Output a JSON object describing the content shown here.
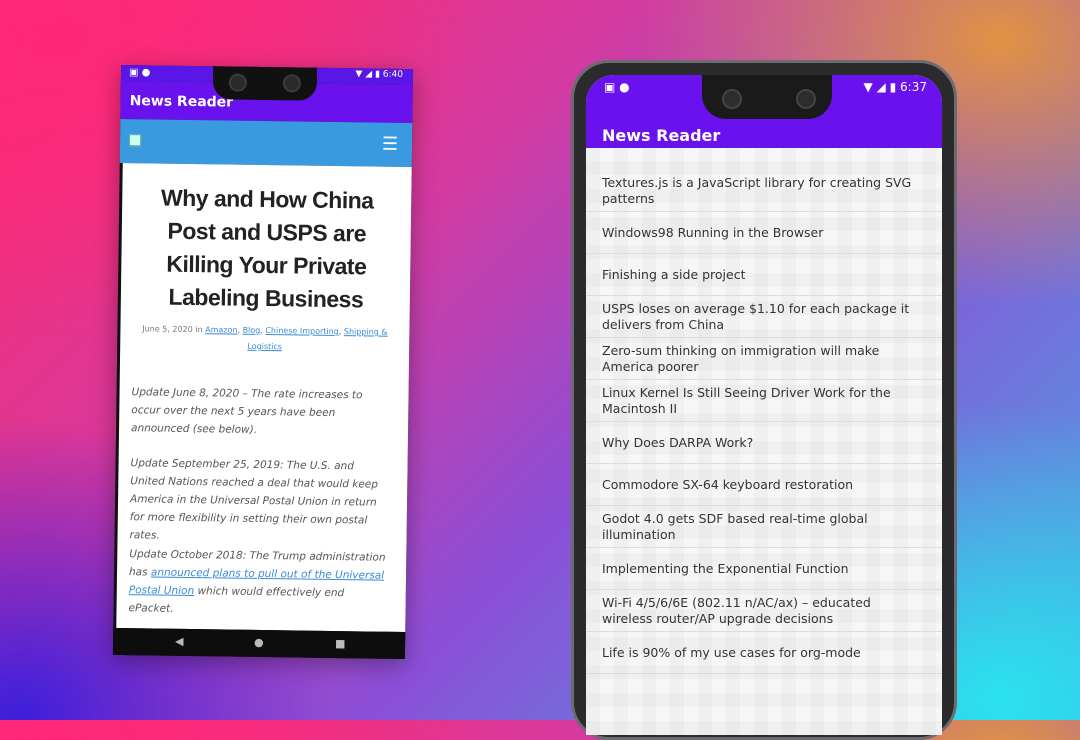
{
  "left_phone": {
    "status_time": "6:40",
    "app_title": "News Reader",
    "article_title": "Why and How China Post and USPS are Killing Your Private Labeling Business",
    "meta": {
      "date_prefix": "June 5, 2020 in ",
      "tags": [
        "Amazon",
        "Blog",
        "Chinese Importing",
        "Shipping & Logistics"
      ]
    },
    "paragraphs": [
      "Update June 8, 2020 – The rate increases to occur over the next 5 years have been announced (see below).",
      "Update September 25, 2019: The U.S. and United Nations reached a deal that would keep America in the Universal Postal Union in return for more flexibility in setting their own postal rates."
    ],
    "para3": {
      "prefix": "Update October 2018: The Trump administration has ",
      "link": "announced plans to pull out of the Universal Postal Union",
      "suffix": " which would effectively end ePacket."
    }
  },
  "right_phone": {
    "status_time": "6:37",
    "app_title": "News Reader",
    "items": [
      "Textures.js is a JavaScript library for creating SVG patterns",
      "Windows98 Running in the Browser",
      "Finishing a side project",
      "USPS loses on average $1.10 for each package it delivers from China",
      "Zero-sum thinking on immigration will make America poorer",
      "Linux Kernel Is Still Seeing Driver Work for the Macintosh II",
      "Why Does DARPA Work?",
      "Commodore SX-64 keyboard restoration",
      "Godot 4.0 gets SDF based real-time global illumination",
      "Implementing the Exponential Function",
      "Wi-Fi 4/5/6/6E (802.11 n/AC/ax) – educated wireless router/AP upgrade decisions",
      "Life is 90% of my use cases for org-mode"
    ]
  },
  "colors": {
    "app_bar": "#6a12ee",
    "site_bar": "#3a9ae0",
    "link": "#3a8ad8"
  }
}
